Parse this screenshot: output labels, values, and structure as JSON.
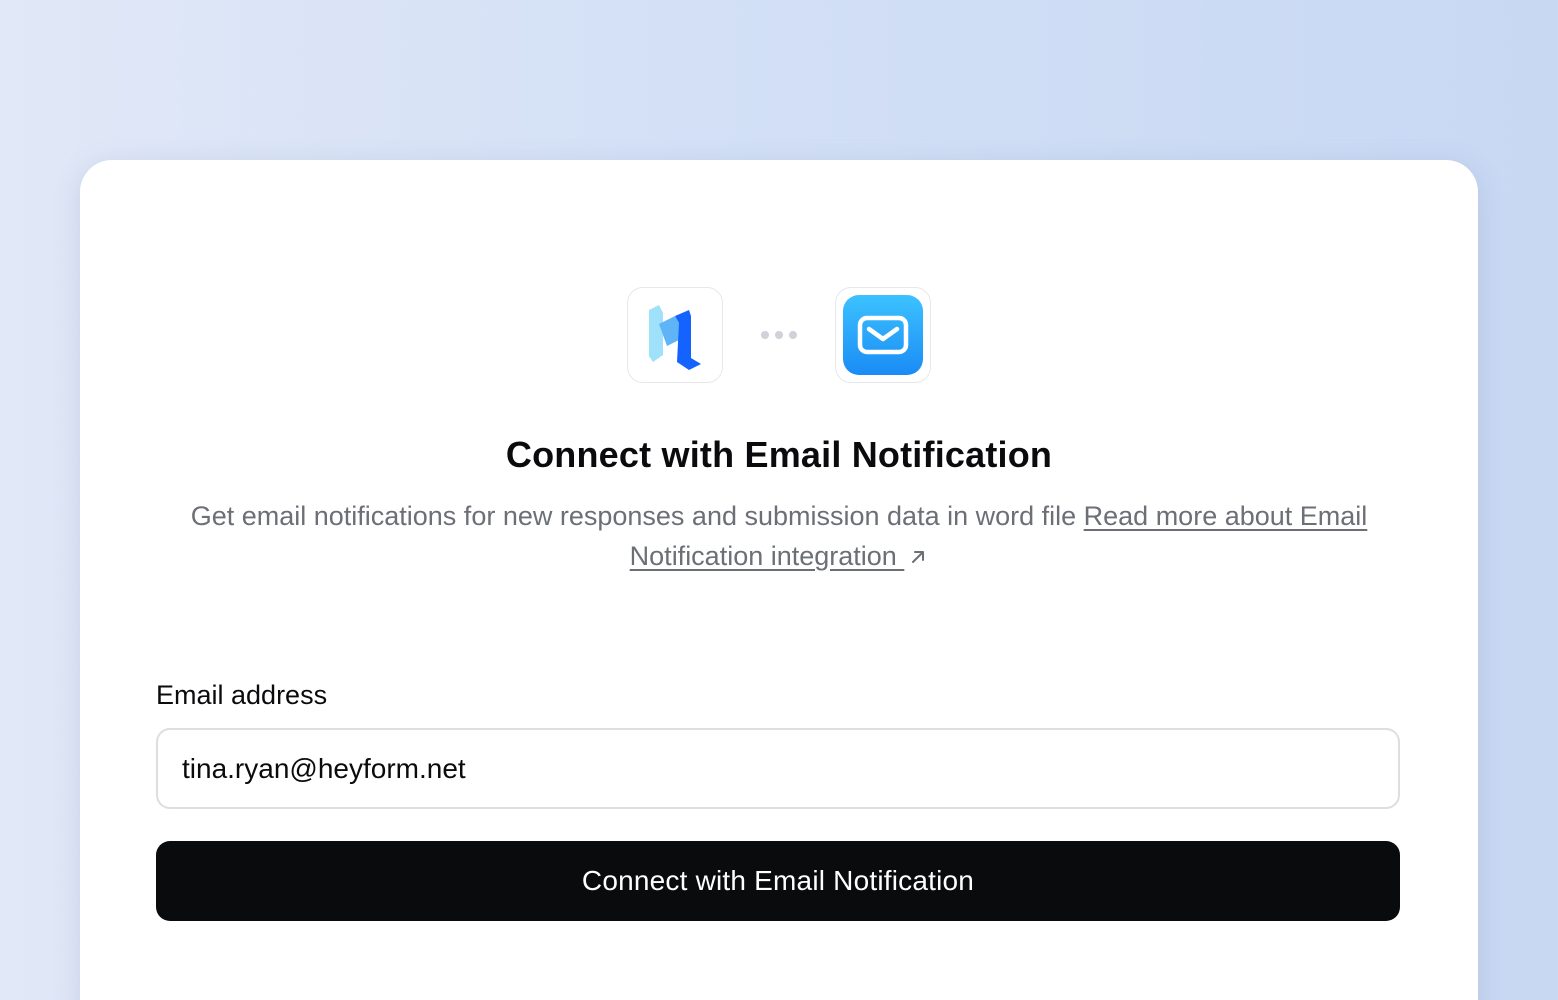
{
  "integration": {
    "source_app_icon": "heyform-logo",
    "connector_icon": "ellipsis-dots",
    "target_app_icon": "mail-envelope-icon",
    "title": "Connect with Email Notification",
    "description": "Get email notifications for new responses and submission data in word file ",
    "read_more_link": "Read more about Email Notification integration ",
    "link_icon": "external-arrow-icon"
  },
  "form": {
    "email_label": "Email address",
    "email_value": "tina.ryan@heyform.net",
    "submit_label": "Connect with Email Notification"
  },
  "colors": {
    "button_bg": "#0a0b0d",
    "mail_tile_top": "#3cc2ff",
    "mail_tile_bottom": "#1a8cf5",
    "logo_light": "#9fe0fb",
    "logo_dark": "#1463ff"
  }
}
